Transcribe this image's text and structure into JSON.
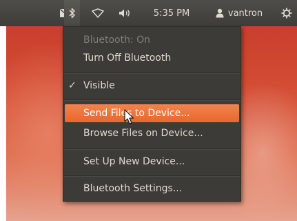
{
  "panel": {
    "time": "5:35 PM",
    "user": "vantron",
    "icons": [
      "mail-icon",
      "bluetooth-icon",
      "network-icon",
      "volume-icon",
      "user-icon",
      "power-icon"
    ]
  },
  "menu": {
    "status": "Bluetooth: On",
    "turn_off": "Turn Off Bluetooth",
    "visible": "Visible",
    "visible_checked": true,
    "send_files": "Send Files to Device...",
    "browse_files": "Browse Files on Device...",
    "setup_device": "Set Up New Device...",
    "settings": "Bluetooth Settings..."
  },
  "colors": {
    "panel_bg": "#3e3d39",
    "menu_bg": "#3c3b37",
    "highlight": "#e9672e",
    "text": "#dfdbd2",
    "disabled_text": "#7f7e79"
  }
}
